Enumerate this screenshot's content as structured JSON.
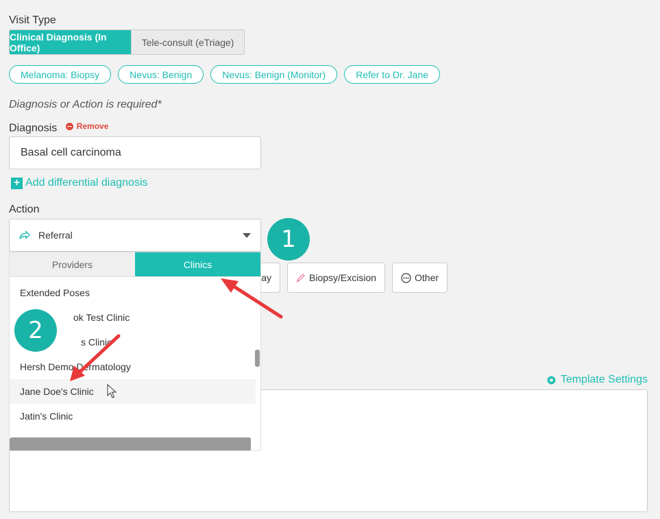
{
  "visit_type": {
    "label": "Visit Type",
    "options": [
      "Clinical Diagnosis (In Office)",
      "Tele-consult (eTriage)"
    ]
  },
  "quick_chips": [
    "Melanoma: Biopsy",
    "Nevus: Benign",
    "Nevus: Benign (Monitor)",
    "Refer to Dr. Jane"
  ],
  "required_note": "Diagnosis or Action is required*",
  "diagnosis": {
    "label": "Diagnosis",
    "remove_label": "Remove",
    "value": "Basal cell carcinoma",
    "add_differential": "Add differential diagnosis"
  },
  "action": {
    "label": "Action",
    "selected": "Referral",
    "buttons": [
      "lay",
      "Biopsy/Excision",
      "Other"
    ]
  },
  "dropdown": {
    "tabs": [
      "Providers",
      "Clinics"
    ],
    "active_tab": "Clinics",
    "items": [
      "Extended Poses",
      "ok Test Clinic",
      "s Clinic",
      "Hersh Demo Dermatology",
      "Jane Doe's Clinic",
      "Jatin's Clinic"
    ],
    "hovered_item": "Jane Doe's Clinic"
  },
  "template_settings": "Template Settings",
  "annotations": {
    "badge1": "1",
    "badge2": "2"
  },
  "colors": {
    "accent": "#1dbdb2",
    "remove": "#e0483b",
    "arrow": "#e8393a"
  }
}
